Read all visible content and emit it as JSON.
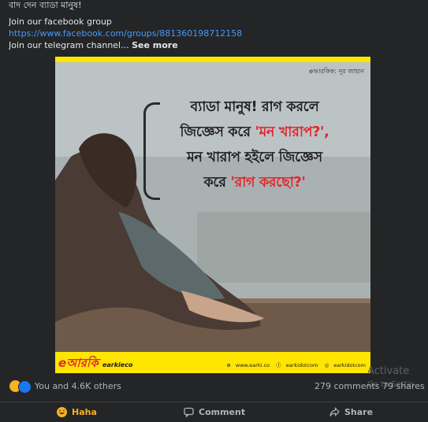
{
  "post": {
    "line1": "বাদ দেন ব্যাডা মানুষ!",
    "line2": "Join our facebook group",
    "link": "https://www.facebook.com/groups/881360198712158",
    "line4": "Join our telegram channel...",
    "see_more": "See more"
  },
  "image": {
    "credit": "eআরকিক: নূর জাহান",
    "quote_1": "ব্যাডা মানুষ! রাগ করলে",
    "quote_2a": "জিজ্ঞেস করে ",
    "quote_2b": "'মন খারাপ?',",
    "quote_3": "মন খারাপ হইলে জিজ্ঞেস",
    "quote_4a": "করে ",
    "quote_4b": "'রাগ করছো?'",
    "brand": "eআরকি",
    "brand_small": "earkieco",
    "site": "www.earki.co",
    "fb": "earkidotcom",
    "ig": "earkidotcom"
  },
  "stats": {
    "reactions_text": "You and 4.6K others",
    "comments": "279 comments",
    "shares": "79 shares"
  },
  "actions": {
    "haha": "Haha",
    "comment": "Comment",
    "share": "Share"
  },
  "watermark": {
    "title": "Activate",
    "sub": "Go to Settin"
  },
  "colors": {
    "background": "#242526",
    "link": "#4599ff",
    "brand_yellow": "#ffe600",
    "accent_red": "#e0262b",
    "haha": "#f7b125"
  }
}
